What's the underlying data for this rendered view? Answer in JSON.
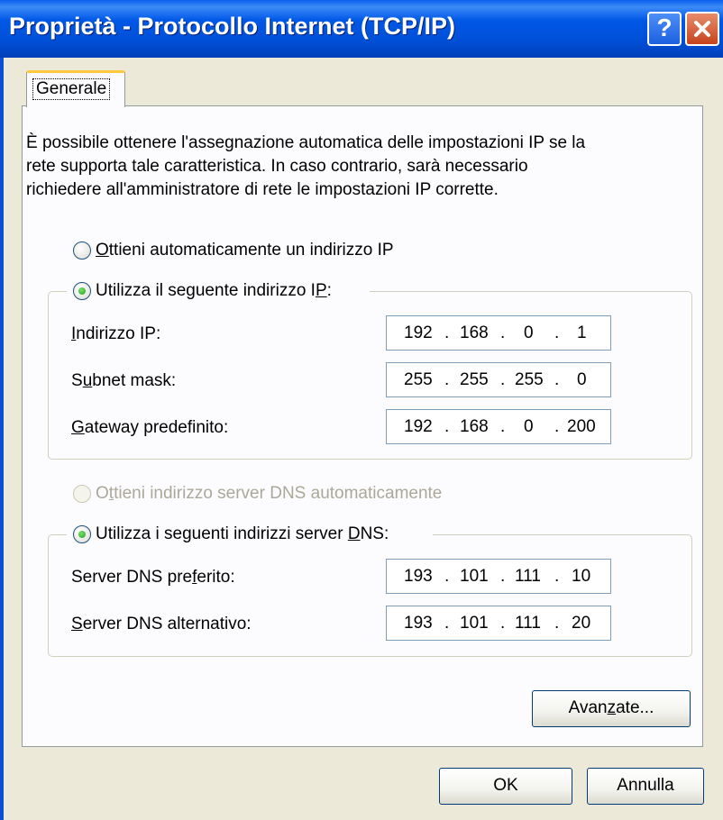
{
  "window": {
    "title": "Proprietà - Protocollo Internet (TCP/IP)",
    "help_button": "?",
    "close_icon": "close-icon"
  },
  "tab": {
    "label": "Generale"
  },
  "intro_lines": [
    "È possibile ottenere l'assegnazione automatica delle impostazioni IP se la",
    "rete supporta tale caratteristica. In caso contrario, sarà necessario",
    "richiedere all'amministratore di rete le impostazioni IP corrette."
  ],
  "ip_section": {
    "auto_option": {
      "pre": "",
      "mnemonic": "O",
      "post": "ttieni automaticamente un indirizzo IP",
      "checked": false
    },
    "manual_option": {
      "pre": "Utilizza il seguente indirizzo I",
      "mnemonic": "P",
      "post": ":",
      "checked": true
    },
    "fields": [
      {
        "pre": "",
        "mnemonic": "I",
        "post": "ndirizzo IP:",
        "octets": [
          "192",
          "168",
          "0",
          "1"
        ]
      },
      {
        "pre": "S",
        "mnemonic": "u",
        "post": "bnet mask:",
        "octets": [
          "255",
          "255",
          "255",
          "0"
        ]
      },
      {
        "pre": "",
        "mnemonic": "G",
        "post": "ateway predefinito:",
        "octets": [
          "192",
          "168",
          "0",
          "200"
        ]
      }
    ]
  },
  "dns_section": {
    "auto_option": {
      "pre": "O",
      "mnemonic": "t",
      "post": "tieni indirizzo server DNS automaticamente",
      "checked": false,
      "disabled": true
    },
    "manual_option": {
      "pre": "Utilizza i seguenti indirizzi server ",
      "mnemonic": "D",
      "post": "NS:",
      "checked": true
    },
    "fields": [
      {
        "pre": "Server DNS pre",
        "mnemonic": "f",
        "post": "erito:",
        "octets": [
          "193",
          "101",
          "111",
          "10"
        ]
      },
      {
        "pre": "",
        "mnemonic": "S",
        "post": "erver DNS alternativo:",
        "octets": [
          "193",
          "101",
          "111",
          "20"
        ]
      }
    ]
  },
  "buttons": {
    "advanced": {
      "pre": "Avan",
      "mnemonic": "z",
      "post": "ate..."
    },
    "ok": "OK",
    "cancel": "Annulla"
  },
  "colors": {
    "titlebar": "#0054e3",
    "dialog_bg": "#ece9d8",
    "tab_accent": "#ffc73c",
    "radio_checked": "#21a121"
  }
}
